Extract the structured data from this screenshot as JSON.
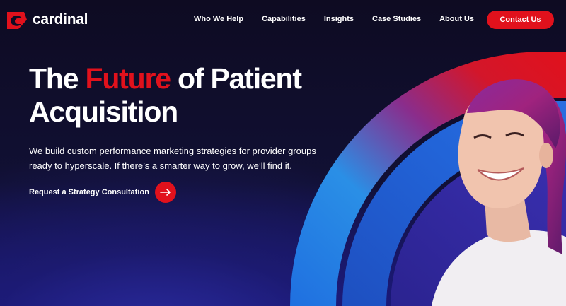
{
  "brand": {
    "name": "cardinal",
    "logo_icon": "cardinal-bird-icon",
    "accent_color": "#e1111c"
  },
  "nav": {
    "items": [
      {
        "label": "Who We Help"
      },
      {
        "label": "Capabilities"
      },
      {
        "label": "Insights"
      },
      {
        "label": "Case Studies"
      },
      {
        "label": "About Us"
      }
    ],
    "contact_label": "Contact Us"
  },
  "hero": {
    "headline_pre": "The ",
    "headline_accent": "Future",
    "headline_post": " of Patient Acquisition",
    "subtext": "We build custom performance marketing strategies for provider groups ready to hyperscale. If there’s a smarter way to grow, we’ll find it.",
    "cta_label": "Request a Strategy Consultation",
    "cta_icon": "arrow-right-icon"
  }
}
